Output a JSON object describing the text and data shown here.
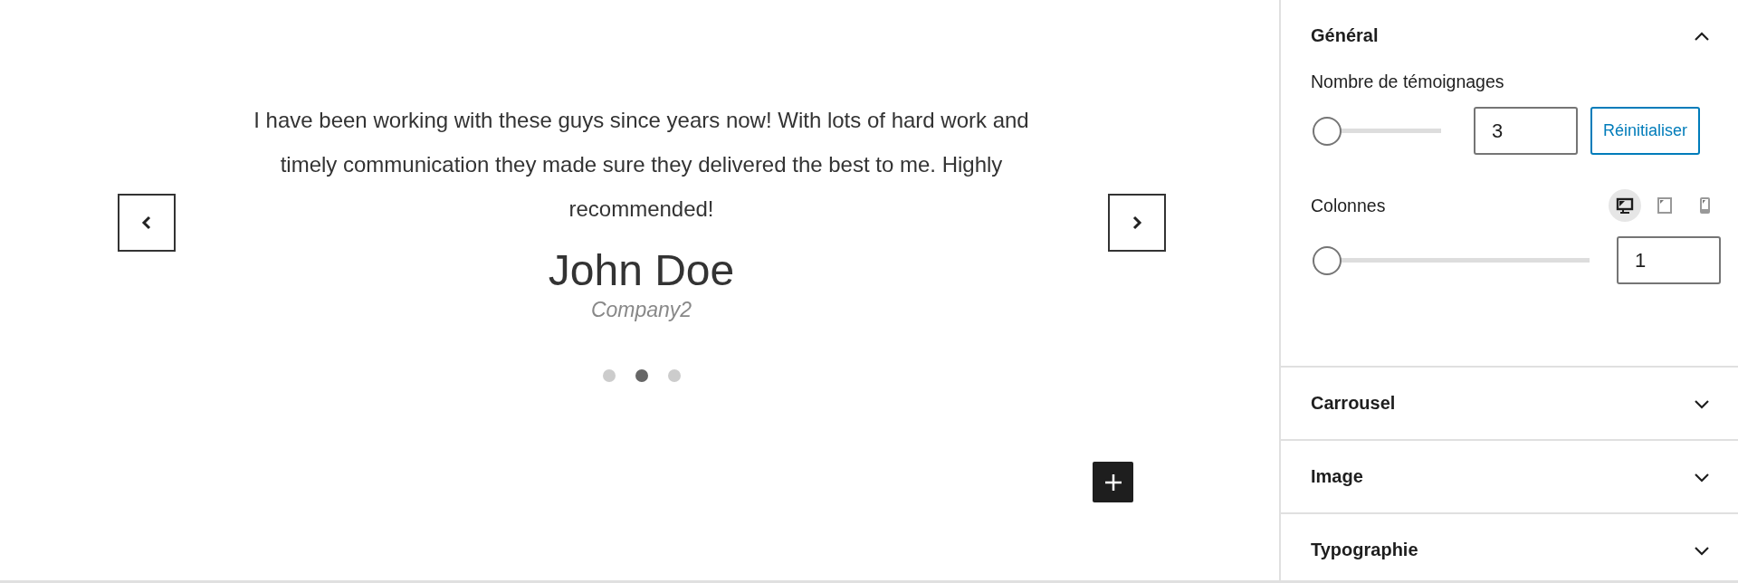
{
  "testimonial": {
    "quote": "I have been working with these guys since years now! With lots of hard work and timely communication they made sure they delivered the best to me. Highly recommended!",
    "name": "John Doe",
    "company": "Company2",
    "dots": [
      {
        "selected": false
      },
      {
        "selected": true
      },
      {
        "selected": false
      }
    ]
  },
  "sidebar": {
    "panels": [
      {
        "title": "Général",
        "expanded": true,
        "fields": [
          {
            "kind": "count",
            "label": "Nombre de témoignages",
            "level": 0,
            "value": "3",
            "button": "Réinitialiser"
          },
          {
            "kind": "responsive",
            "label": "Colonnes",
            "level": 0,
            "value": "1",
            "devices": [
              {
                "kind": "desktop",
                "selected": true
              },
              {
                "kind": "tablet",
                "selected": false
              },
              {
                "kind": "mobile",
                "selected": false
              }
            ]
          }
        ]
      },
      {
        "title": "Carrousel",
        "expanded": false
      },
      {
        "title": "Image",
        "expanded": false
      },
      {
        "title": "Typographie",
        "expanded": false
      }
    ]
  }
}
